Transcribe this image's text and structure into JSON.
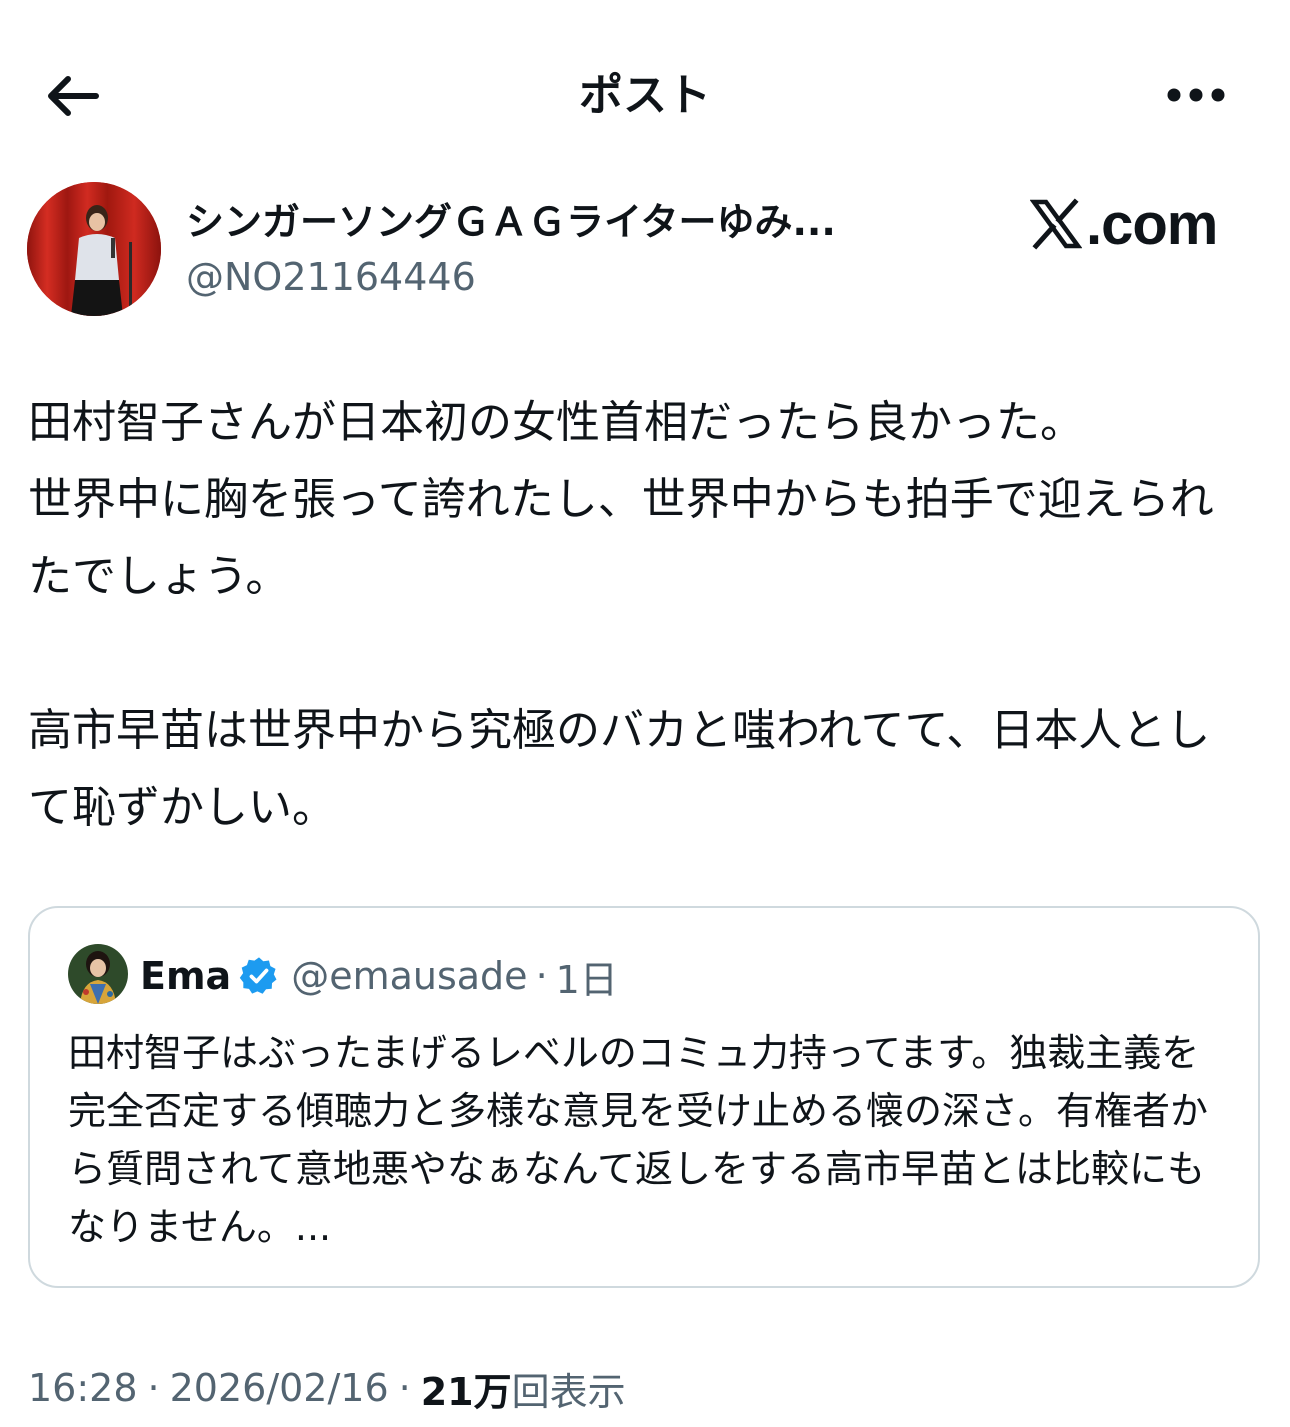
{
  "header": {
    "title": "ポスト",
    "back_icon": "arrow-left-icon",
    "more_icon": "more-horizontal-icon"
  },
  "author": {
    "display_name": "シンガーソングＧＡＧライターゆみ...",
    "handle": "@NO21164446"
  },
  "watermark": {
    "text": ".com",
    "logo_icon": "x-logo-icon"
  },
  "post": {
    "lines": [
      "田村智子さんが日本初の女性首相だったら良かった。",
      "世界中に胸を張って誇れたし、世界中からも拍手で迎えられたでしょう。"
    ],
    "paragraph2": "高市早苗は世界中から究極のバカと嗤われてて、日本人として恥ずかしい。"
  },
  "quote": {
    "name": "Ema",
    "verified_icon": "verified-badge-icon",
    "handle": "@emausade",
    "separator": "·",
    "time": "1日",
    "text": "田村智子はぶったまげるレベルのコミュ力持ってます。独裁主義を完全否定する傾聴力と多様な意見を受け止める懐の深さ。有権者から質問されて意地悪やなぁなんて返しをする高市早苗とは比較にもなりません。..."
  },
  "meta": {
    "time": "16:28",
    "date": "2026/02/16",
    "separator": "·",
    "views_count": "21万",
    "views_label": "回表示"
  },
  "colors": {
    "text_primary": "#0f1419",
    "text_secondary": "#536471",
    "border": "#cfd9de",
    "verified_blue": "#1d9bf0",
    "avatar_red": "#c0241c"
  }
}
